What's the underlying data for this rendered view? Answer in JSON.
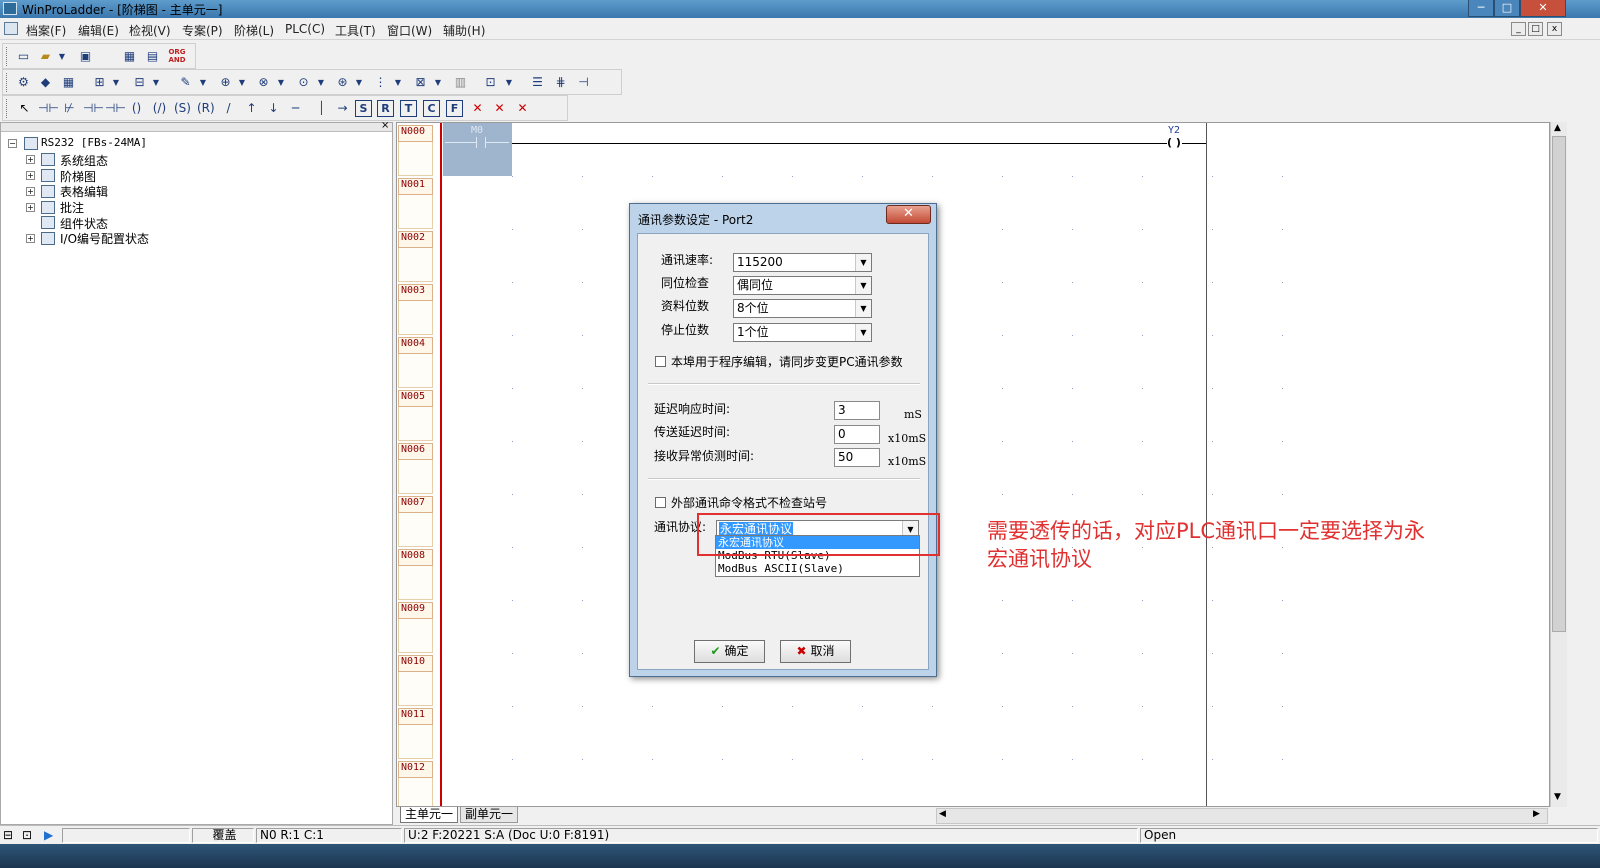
{
  "window": {
    "title": "WinProLadder - [阶梯图 - 主单元一]",
    "controls": [
      "─",
      "□",
      "✕"
    ]
  },
  "menu": {
    "items": [
      "档案(F)",
      "编辑(E)",
      "检视(V)",
      "专案(P)",
      "阶梯(L)",
      "PLC(C)",
      "工具(T)",
      "窗口(W)",
      "辅助(H)"
    ],
    "mdi_controls": [
      "_",
      "□",
      "x"
    ]
  },
  "toolbar": {
    "org_and": "ORG AND"
  },
  "tree": {
    "root": "RS232 [FBs-24MA]",
    "items": [
      "系统组态",
      "阶梯图",
      "表格编辑",
      "批注",
      "组件状态",
      "I/O编号配置状态"
    ],
    "icons": [
      "system-config-icon",
      "ladder-icon",
      "table-edit-icon",
      "comment-icon",
      "component-status-icon",
      "io-config-icon"
    ]
  },
  "ladder": {
    "networks": [
      "N000",
      "N001",
      "N002",
      "N003",
      "N004",
      "N005",
      "N006",
      "N007",
      "N008",
      "N009",
      "N010",
      "N011",
      "N012"
    ],
    "contact_label": "M0",
    "coil_label": "Y2"
  },
  "dialog": {
    "title": "通讯参数设定 - Port2",
    "fields": [
      {
        "label": "通讯速率:",
        "value": "115200"
      },
      {
        "label": "同位检查",
        "value": "偶同位"
      },
      {
        "label": "资料位数",
        "value": "8个位"
      },
      {
        "label": "停止位数",
        "value": "1个位"
      }
    ],
    "sync_checkbox": "本埠用于程序编辑，请同步变更PC通讯参数",
    "timing": [
      {
        "label": "延迟响应时间:",
        "value": "3",
        "unit": "mS"
      },
      {
        "label": "传送延迟时间:",
        "value": "0",
        "unit": "x10mS"
      },
      {
        "label": "接收异常侦测时间:",
        "value": "50",
        "unit": "x10mS"
      }
    ],
    "station_checkbox": "外部通讯命令格式不检查站号",
    "protocol_label": "通讯协议:",
    "protocol_value": "永宏通讯协议",
    "protocol_options": [
      "永宏通讯协议",
      "ModBus RTU(Slave)",
      "ModBus ASCII(Slave)"
    ],
    "ok_label": "确定",
    "cancel_label": "取消"
  },
  "annotation": "需要透传的话，对应PLC通讯口一定要选择为永宏通讯协议",
  "tabs": [
    "主单元一",
    "副单元一"
  ],
  "status": {
    "mode": "覆盖",
    "position": "N0 R:1 C:1",
    "info": "U:2 F:20221 S:A (Doc U:0 F:8191)",
    "port": "Open"
  },
  "colors": {
    "annotation": "#e03030",
    "network_label": "#8b0000",
    "selection": "#3399ff",
    "power_rail": "#cc0000"
  }
}
